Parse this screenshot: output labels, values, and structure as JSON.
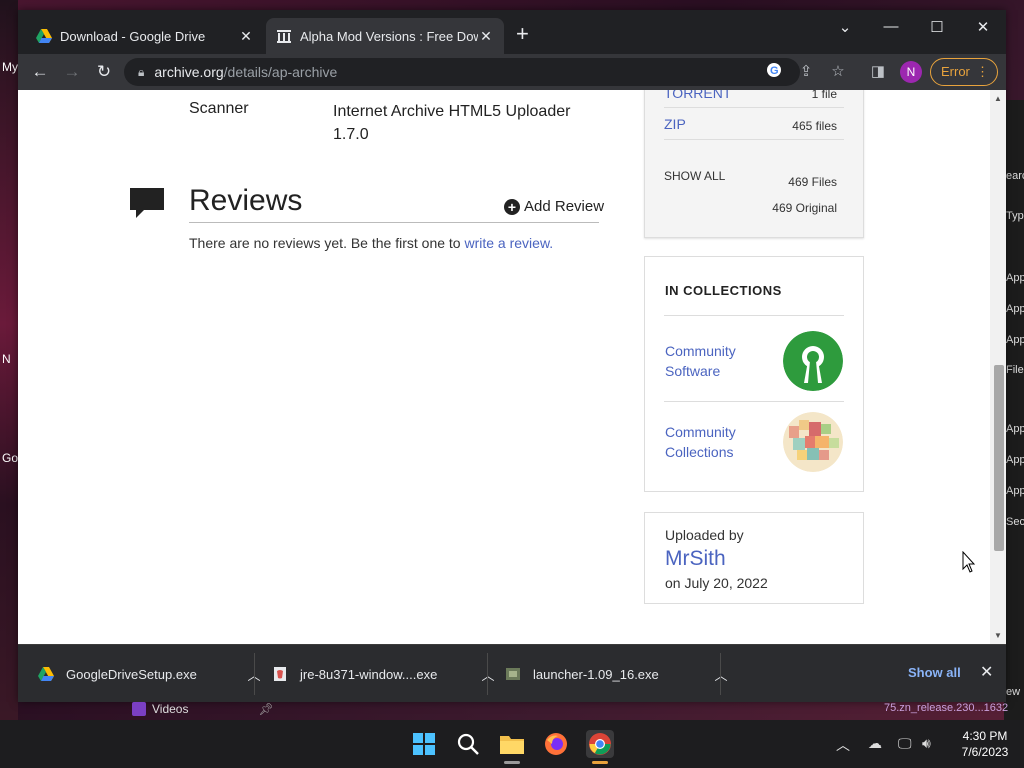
{
  "desktop": {
    "left_labels": [
      "My",
      "N",
      "Go"
    ],
    "right_labels": [
      "earc",
      "Type",
      "App",
      "App",
      "App",
      "File",
      "App",
      "App",
      "App",
      "Secu",
      "ew"
    ],
    "videos_label": "Videos",
    "release_text": "75.zn_release.230...1632"
  },
  "tabs": [
    {
      "title": "Download - Google Drive",
      "icon": "google-drive-icon"
    },
    {
      "title": "Alpha Mod Versions : Free Downl",
      "icon": "archive-icon"
    }
  ],
  "toolbar": {
    "url_host": "archive.org",
    "url_path": "/details/ap-archive",
    "profile_initial": "N",
    "error_label": "Error"
  },
  "metadata": {
    "key": "Scanner",
    "value": "Internet Archive HTML5 Uploader 1.7.0"
  },
  "reviews": {
    "title": "Reviews",
    "add_label": "Add Review",
    "empty_text": "There are no reviews yet. Be the first one to ",
    "link_text": "write a review."
  },
  "files": {
    "torrent_label": "TORRENT",
    "torrent_count": "1 file",
    "zip_label": "ZIP",
    "zip_count": "465 files",
    "show_all_label": "SHOW ALL",
    "total_files": "469 Files",
    "total_original": "469 Original"
  },
  "collections": {
    "heading": "IN COLLECTIONS",
    "items": [
      {
        "name": "Community Software"
      },
      {
        "name": "Community Collections"
      }
    ]
  },
  "uploader": {
    "label": "Uploaded by",
    "name": "MrSith",
    "date": "on July 20, 2022"
  },
  "downloads": [
    {
      "name": "GoogleDriveSetup.exe"
    },
    {
      "name": "jre-8u371-window....exe"
    },
    {
      "name": "launcher-1.09_16.exe"
    }
  ],
  "shelf": {
    "show_all": "Show all"
  },
  "clock": {
    "time": "4:30 PM",
    "date": "7/6/2023"
  },
  "colors": {
    "link": "#4b64c0",
    "community_software": "#2e9b3d",
    "error": "#e8a33d"
  }
}
